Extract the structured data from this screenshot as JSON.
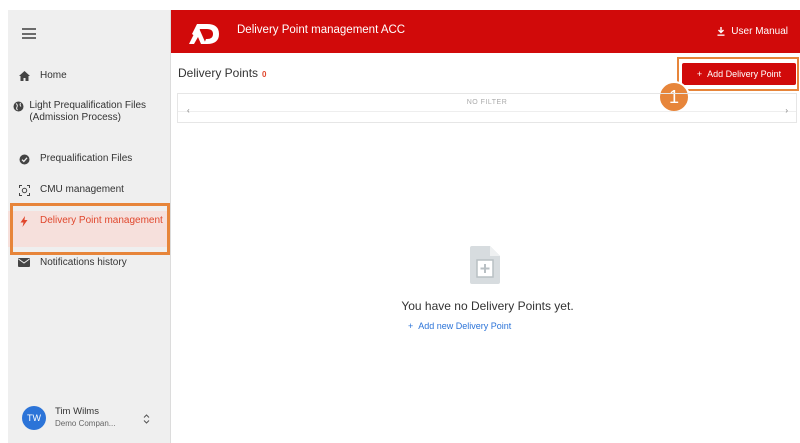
{
  "app": {
    "title": "Delivery Point management ACC",
    "user_manual": "User Manual"
  },
  "sidebar": {
    "items": [
      {
        "label": "Home",
        "icon": "home-icon"
      },
      {
        "label": "Light Prequalification Files (Admission Process)",
        "icon": "globe-icon"
      },
      {
        "label": "Prequalification Files",
        "icon": "verified-badge-icon"
      },
      {
        "label": "CMU management",
        "icon": "scan-icon"
      },
      {
        "label": "Delivery Point management",
        "icon": "bolt-icon",
        "active": true
      },
      {
        "label": "Notifications history",
        "icon": "mail-icon"
      }
    ],
    "user": {
      "initials": "TW",
      "name": "Tim Wilms",
      "company": "Demo Compan..."
    }
  },
  "main": {
    "title": "Delivery Points",
    "count": "0",
    "add_button": "Add Delivery Point",
    "filter": "NO FILTER",
    "empty_message": "You have no Delivery Points yet.",
    "empty_link": "Add new Delivery Point"
  },
  "annotation": {
    "step": "1"
  },
  "colors": {
    "brand_red": "#d10a0a",
    "accent_orange": "#e7853a",
    "link_blue": "#2c74d8"
  }
}
